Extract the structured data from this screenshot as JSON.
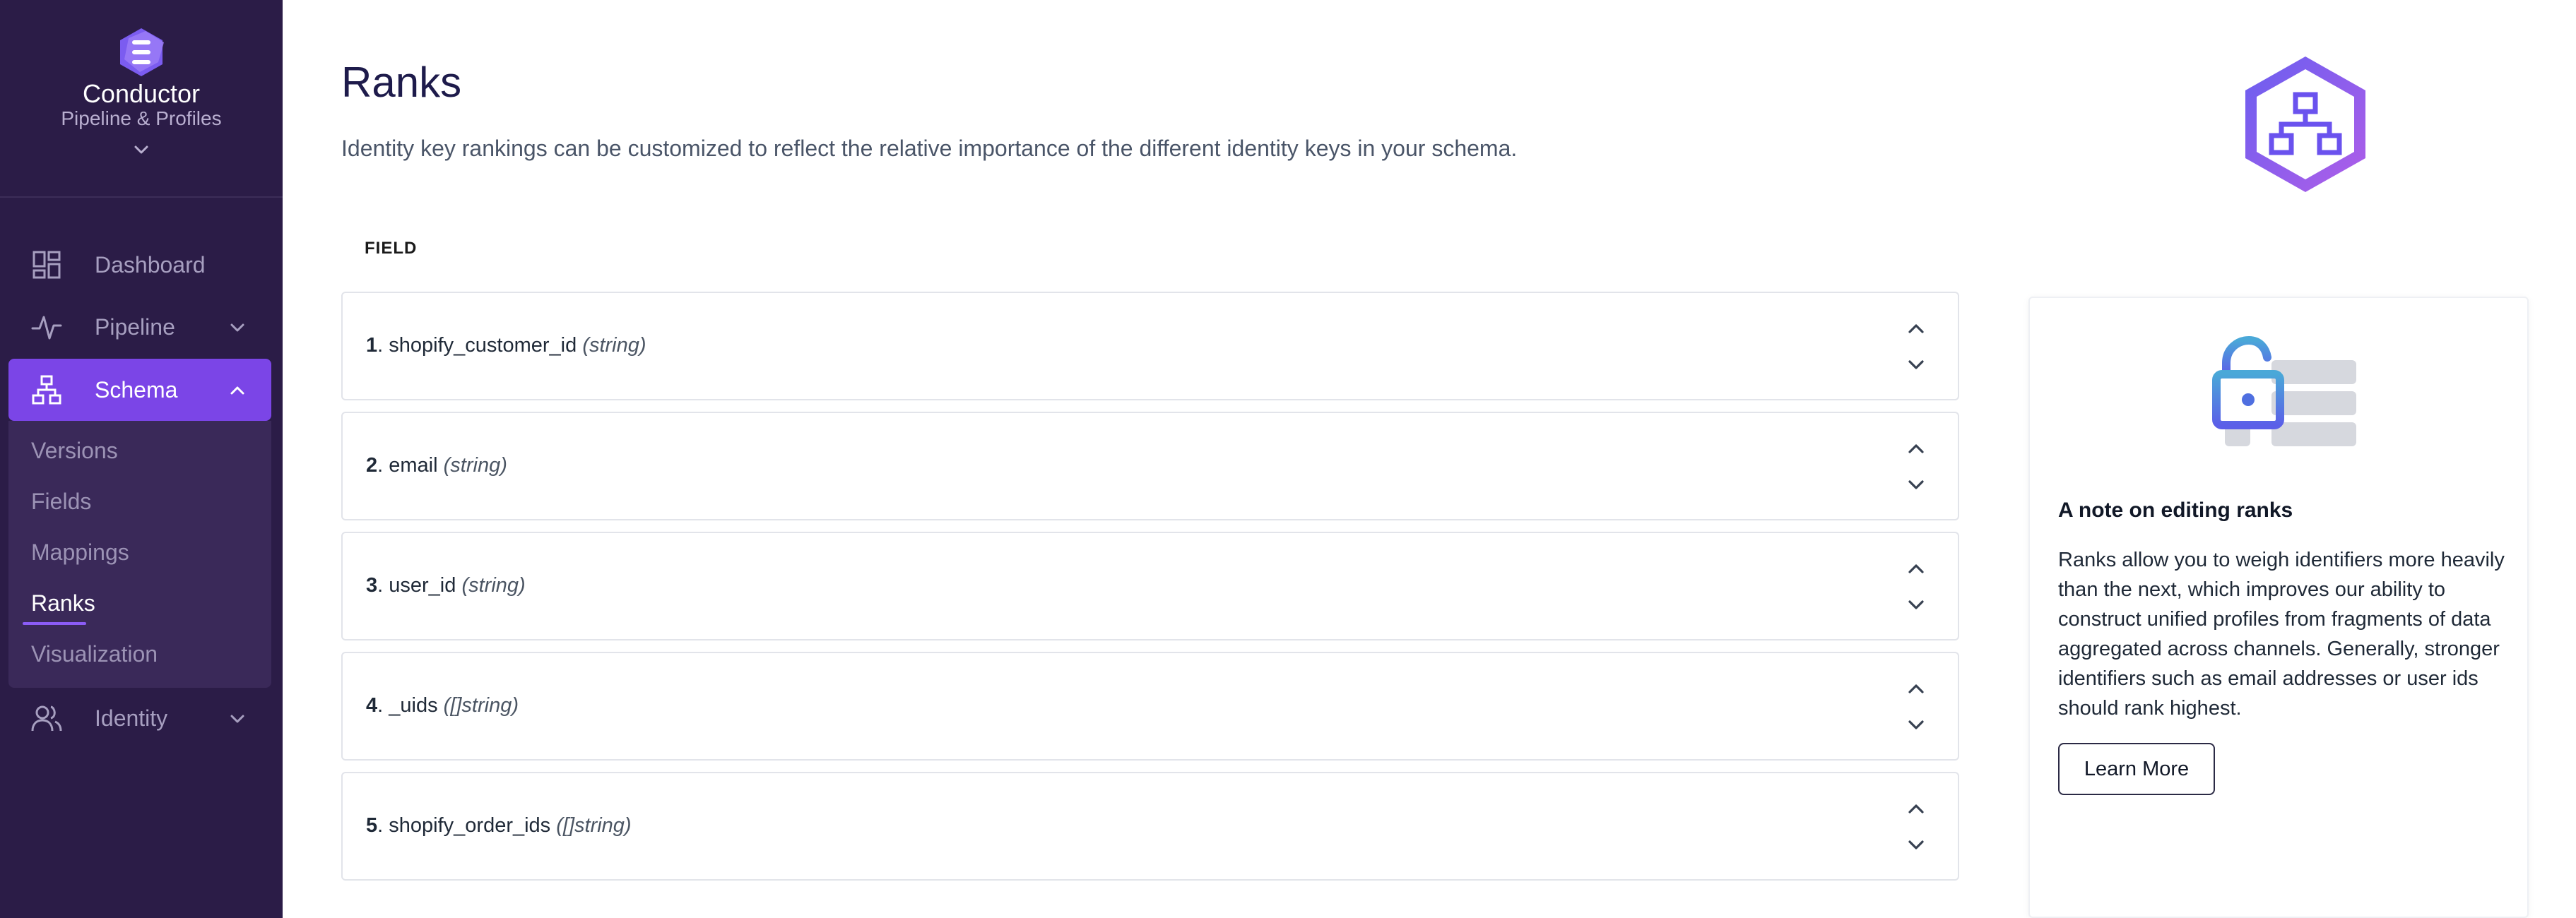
{
  "brand": {
    "name": "Conductor",
    "subtitle": "Pipeline & Profiles",
    "logo_icon": "layered-hexagon-logo-icon",
    "accent": "#7b45e7",
    "sidebar_bg": "#2b1c47"
  },
  "sidebar": {
    "items": [
      {
        "label": "Dashboard",
        "icon": "grid-layout-icon"
      },
      {
        "label": "Pipeline",
        "icon": "activity-pulse-icon"
      },
      {
        "label": "Schema",
        "icon": "hierarchy-icon",
        "active": true
      },
      {
        "label": "Identity",
        "icon": "users-icon"
      }
    ],
    "schema_sub": [
      {
        "label": "Versions"
      },
      {
        "label": "Fields"
      },
      {
        "label": "Mappings"
      },
      {
        "label": "Ranks",
        "active": true
      },
      {
        "label": "Visualization"
      }
    ]
  },
  "main": {
    "title": "Ranks",
    "description": "Identity key rankings can be customized to reflect the relative importance of the different identity keys in your schema.",
    "field_header": "FIELD",
    "ranks": [
      {
        "num": "1",
        "name": "shopify_customer_id",
        "type": "(string)"
      },
      {
        "num": "2",
        "name": "email",
        "type": "(string)"
      },
      {
        "num": "3",
        "name": "user_id",
        "type": "(string)"
      },
      {
        "num": "4",
        "name": "_uids",
        "type": "([]string)"
      },
      {
        "num": "5",
        "name": "shopify_order_ids",
        "type": "([]string)"
      }
    ]
  },
  "note": {
    "title": "A note on editing ranks",
    "body": "Ranks allow you to weigh identifiers more heavily than the next, which improves our ability to construct unified profiles from fragments of data aggregated across channels. Generally, stronger identifiers such as email addresses or user ids should rank highest.",
    "button": "Learn More"
  }
}
